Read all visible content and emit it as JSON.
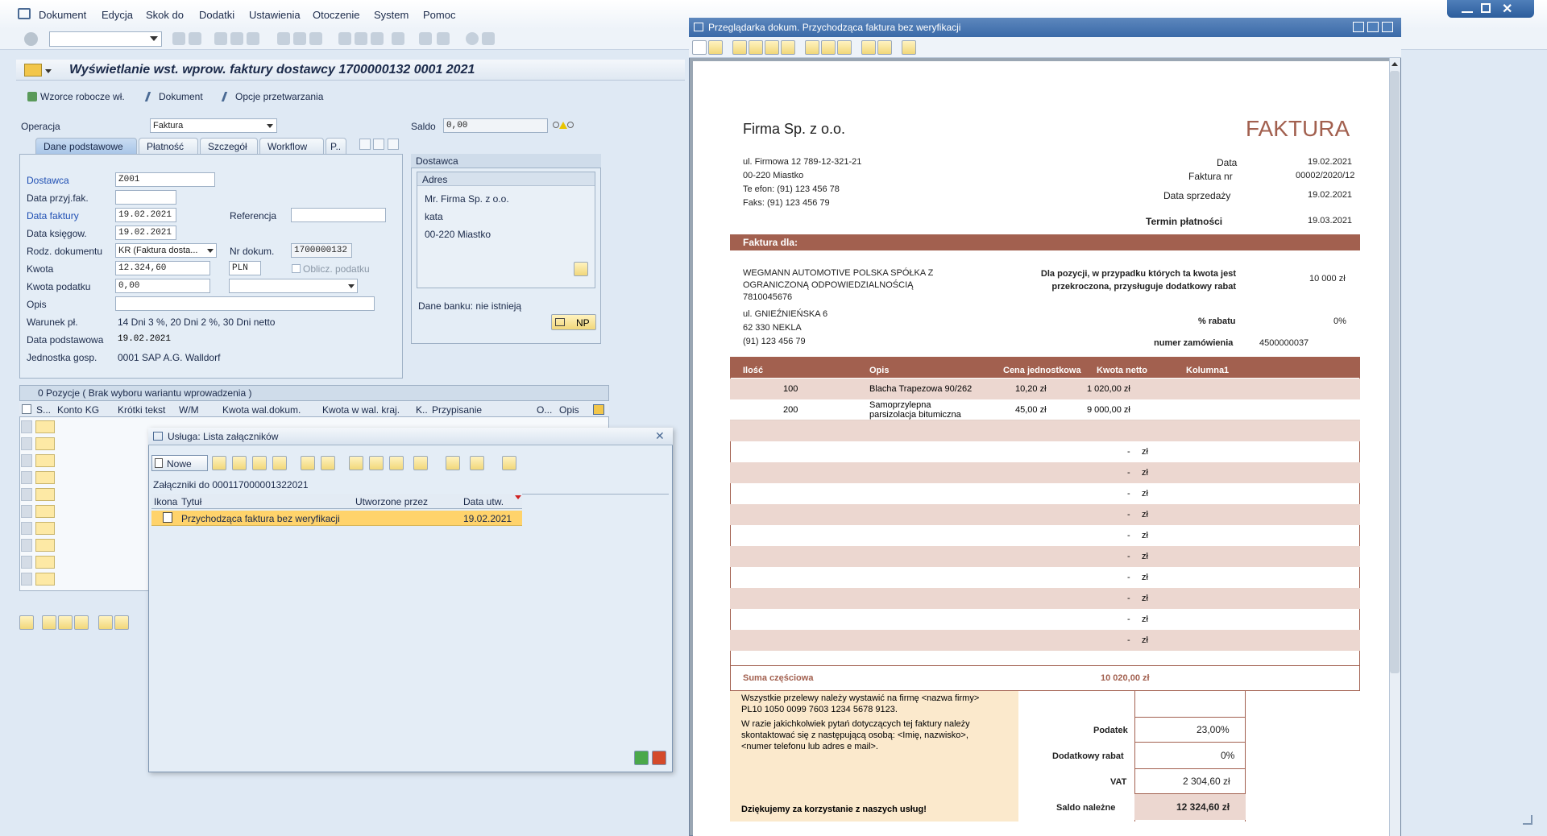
{
  "menu": [
    "Dokument",
    "Edycja",
    "Skok do",
    "Dodatki",
    "Ustawienia",
    "Otoczenie",
    "System",
    "Pomoc"
  ],
  "app_title": "Wyświetlanie wst. wprow. faktury dostawcy 1700000132 0001 2021",
  "app_toolbar": {
    "drafts": "Wzorce robocze wł.",
    "document": "Dokument",
    "options": "Opcje przetwarzania"
  },
  "header": {
    "operation_label": "Operacja",
    "operation_value": "Faktura",
    "saldo_label": "Saldo",
    "saldo_value": "0,00"
  },
  "tabs": [
    "Dane podstawowe",
    "Płatność",
    "Szczegół",
    "Workflow",
    "P.."
  ],
  "basic": {
    "vendor_label": "Dostawca",
    "vendor_value": "Z001",
    "receipt_label": "Data przyj.fak.",
    "invoice_date_label": "Data faktury",
    "invoice_date_value": "19.02.2021",
    "reference_label": "Referencja",
    "posting_date_label": "Data księgow.",
    "posting_date_value": "19.02.2021",
    "doctype_label": "Rodz. dokumentu",
    "doctype_value": "KR (Faktura dosta...",
    "docno_label": "Nr dokum.",
    "docno_value": "1700000132",
    "amount_label": "Kwota",
    "amount_value": "12.324,60",
    "currency_value": "PLN",
    "calc_tax_label": "Oblicz. podatku",
    "tax_label": "Kwota podatku",
    "tax_value": "0,00",
    "desc_label": "Opis",
    "terms_label": "Warunek pł.",
    "terms_value": "14 Dni 3 %, 20 Dni 2 %, 30 Dni netto",
    "base_date_label": "Data podstawowa",
    "base_date_value": "19.02.2021",
    "company_label": "Jednostka gosp.",
    "company_value": "0001 SAP A.G. Walldorf"
  },
  "vendor_box": {
    "title": "Dostawca",
    "address_title": "Adres",
    "lines": [
      "Mr. Firma Sp. z o.o.",
      "kata",
      "00-220 Miastko"
    ],
    "bank": "Dane banku: nie istnieją",
    "np_label": "NP"
  },
  "positions": {
    "title": "0 Pozycje ( Brak wyboru wariantu wprowadzenia )",
    "columns": [
      "S...",
      "Konto KG",
      "Krótki tekst",
      "W/M",
      "Kwota wal.dokum.",
      "Kwota w wal. kraj.",
      "K..",
      "Przypisanie",
      "O...",
      "Opis"
    ]
  },
  "attach_dialog": {
    "title": "Usługa: Lista załączników",
    "new_label": "Nowe",
    "heading": "Załączniki do 000117000001322021",
    "columns": [
      "Ikona",
      "Tytuł",
      "Utworzone przez",
      "Data utw."
    ],
    "rows": [
      {
        "title": "Przychodząca faktura bez weryfikacji",
        "created_by": "",
        "date": "19.02.2021"
      }
    ]
  },
  "viewer": {
    "title": "Przeglądarka dokum.  Przychodząca faktura bez  weryfikacji",
    "invoice": {
      "company": "Firma Sp. z o.o.",
      "heading": "FAKTURA",
      "addr": [
        "ul. Firmowa 12  789-12-321-21",
        "00-220 Miastko",
        "Te efon: (91) 123 456 78",
        "Faks: (91) 123 456 79"
      ],
      "meta": [
        [
          "Data",
          "19.02.2021"
        ],
        [
          "Faktura nr",
          "00002/2020/12"
        ],
        [
          "Data sprzedaży",
          "19.02.2021"
        ],
        [
          "Termin płatności",
          "19.03.2021"
        ]
      ],
      "bill_to_label": "Faktura dla:",
      "buyer": [
        "WEGMANN AUTOMOTIVE POLSKA SPÓŁKA Z",
        "OGRANICZONĄ ODPOWIEDZIALNOŚCIĄ",
        "7810045676",
        "ul. GNIEŹNIEŃSKA 6",
        "62 330 NEKLA",
        "(91) 123 456 79"
      ],
      "discount_note": "Dla pozycji, w przypadku których ta kwota jest przekroczona, przysługuje dodatkowy rabat",
      "discount_threshold": "10 000 zł",
      "rabat_label": "% rabatu",
      "rabat_value": "0%",
      "order_label": "numer zamówienia",
      "order_value": "4500000037",
      "cols": [
        "Ilość",
        "Opis",
        "Cena jednostkowa",
        "Kwota netto",
        "Kolumna1"
      ],
      "items": [
        {
          "qty": "100",
          "desc": "Blacha Trapezowa 90/262",
          "price": "10,20 zł",
          "net": "1 020,00 zł"
        },
        {
          "qty": "200",
          "desc": "Samoprzylepna parsizolacja bitumiczna",
          "price": "45,00 zł",
          "net": "9 000,00 zł"
        }
      ],
      "empty_dash": "-",
      "empty_cur": "zł",
      "subtotal_label": "Suma częściowa",
      "subtotal_value": "10 020,00 zł",
      "note": [
        "Wszystkie przelewy należy wystawić na firmę <nazwa firmy>",
        "PL10 1050 0099 7603 1234 5678 9123.",
        "W razie jakichkolwiek pytań dotyczących tej faktury należy",
        "skontaktować się z następującą osobą: <Imię, nazwisko>,",
        "<numer telefonu lub adres e mail>."
      ],
      "thanks": "Dziękujemy za korzystanie z naszych usług!",
      "totals": [
        [
          "Podatek",
          "23,00%"
        ],
        [
          "Dodatkowy rabat",
          "0%"
        ],
        [
          "VAT",
          "2 304,60 zł"
        ],
        [
          "Saldo należne",
          "12 324,60 zł"
        ]
      ]
    }
  },
  "colors": {
    "invoice_brown": "#a2604f",
    "invoice_pink": "#ecd7d0",
    "note_bg": "#fbe9cc",
    "selection": "#ffd36b"
  }
}
